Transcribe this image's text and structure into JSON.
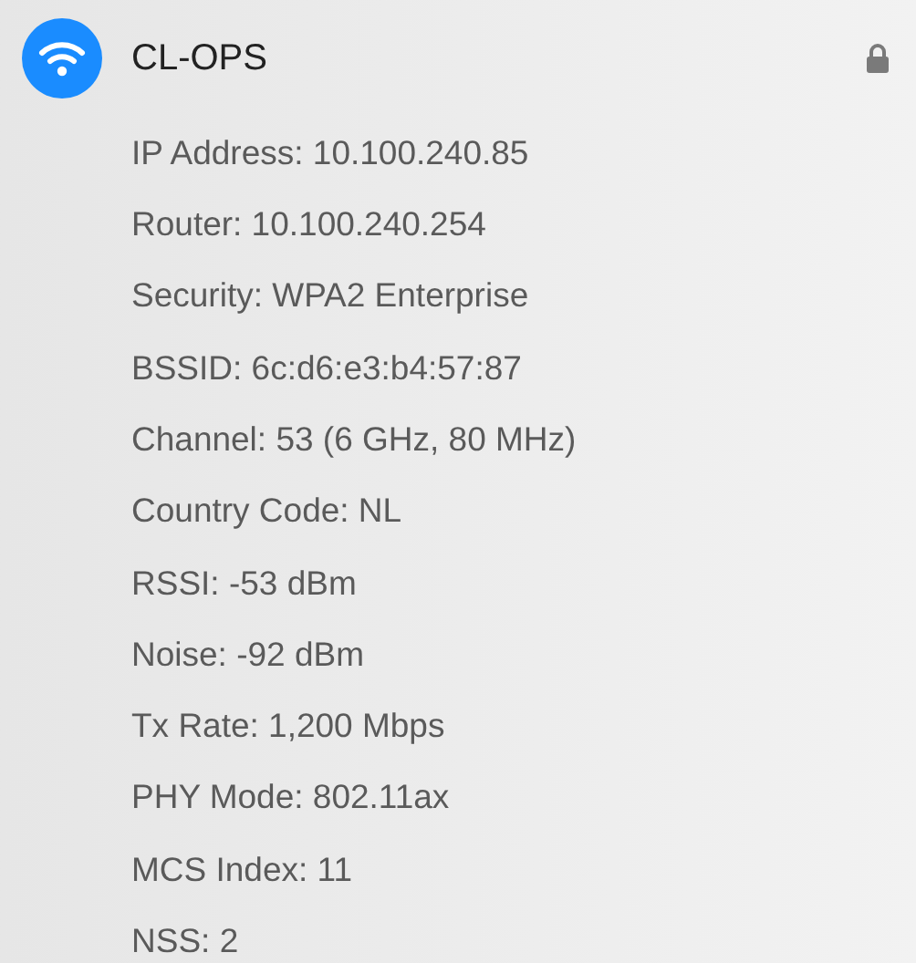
{
  "network": {
    "name": "CL-OPS",
    "connected": true,
    "locked": true
  },
  "details": [
    "IP Address: 10.100.240.85",
    "Router: 10.100.240.254",
    "Security: WPA2 Enterprise",
    "BSSID: 6c:d6:e3:b4:57:87",
    "Channel: 53 (6 GHz, 80 MHz)",
    "Country Code: NL",
    "RSSI: -53 dBm",
    "Noise: -92 dBm",
    "Tx Rate: 1,200 Mbps",
    "PHY Mode: 802.11ax",
    "MCS Index: 11",
    "NSS: 2"
  ]
}
